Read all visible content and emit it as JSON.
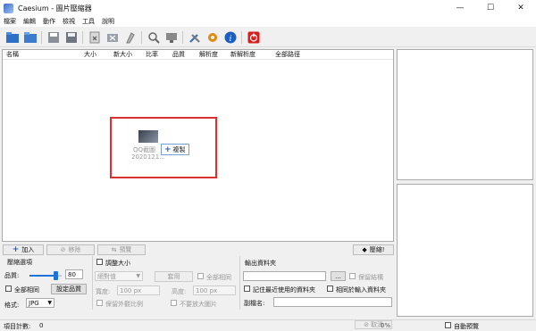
{
  "window": {
    "title": "Caesium - 圖片壓縮器",
    "minimize": "—",
    "maximize": "☐",
    "close": "✕"
  },
  "menu": [
    "檔案",
    "編輯",
    "動作",
    "檢視",
    "工具",
    "說明"
  ],
  "toolbar_icons": [
    "open-file-icon",
    "open-folder-icon",
    "save-icon",
    "save-all-icon",
    "remove-icon",
    "clear-list-icon",
    "clean-icon",
    "search-icon",
    "monitor-icon",
    "tools-icon",
    "settings-gear-icon",
    "info-icon",
    "power-icon"
  ],
  "colors": {
    "accent": "#1c74d8",
    "highlight_border": "#d93030",
    "power": "#d62020",
    "info": "#1c5fc4",
    "gear": "#e08a10"
  },
  "list": {
    "columns": [
      "名稱",
      "大小",
      "新大小",
      "比率",
      "品質",
      "解析度",
      "新解析度",
      "全部路徑"
    ],
    "drag_file_name_line1": "QQ截圖",
    "drag_file_name_line2": "2020121...",
    "copy_tooltip": "複製"
  },
  "actions": {
    "add": "加入",
    "remove": "移除",
    "preview": "預覽",
    "compress": "壓縮!"
  },
  "compression": {
    "group_label": "壓縮選項",
    "quality_label": "品質:",
    "quality_value": "80",
    "quality_fraction": 0.8,
    "same_all_label": "全部相同",
    "set_quality_button": "設定品質",
    "format_label": "格式:",
    "format_value": "JPG"
  },
  "resize": {
    "checkbox_label": "調整大小",
    "mode_value": "絕對值",
    "apply_button": "套用",
    "same_all_label": "全部相同",
    "width_label": "寬度:",
    "width_value": "100 px",
    "height_label": "高度:",
    "height_value": "100 px",
    "keep_ratio_label": "保留外觀比例",
    "no_enlarge_label": "不要放大圖片"
  },
  "output": {
    "group_label": "輸出資料夾",
    "path_value": "",
    "browse_button": "...",
    "keep_structure_label": "保留結構",
    "remember_last_label": "記住最近使用的資料夾",
    "same_as_input_label": "相同於輸入資料夾",
    "suffix_label": "副檔名:",
    "suffix_value": ""
  },
  "bottom": {
    "item_count_label": "項目計數:",
    "item_count_value": "0",
    "cancel_button": "取消",
    "auto_preview_label": "自動預覽",
    "progress_text": "0%"
  }
}
